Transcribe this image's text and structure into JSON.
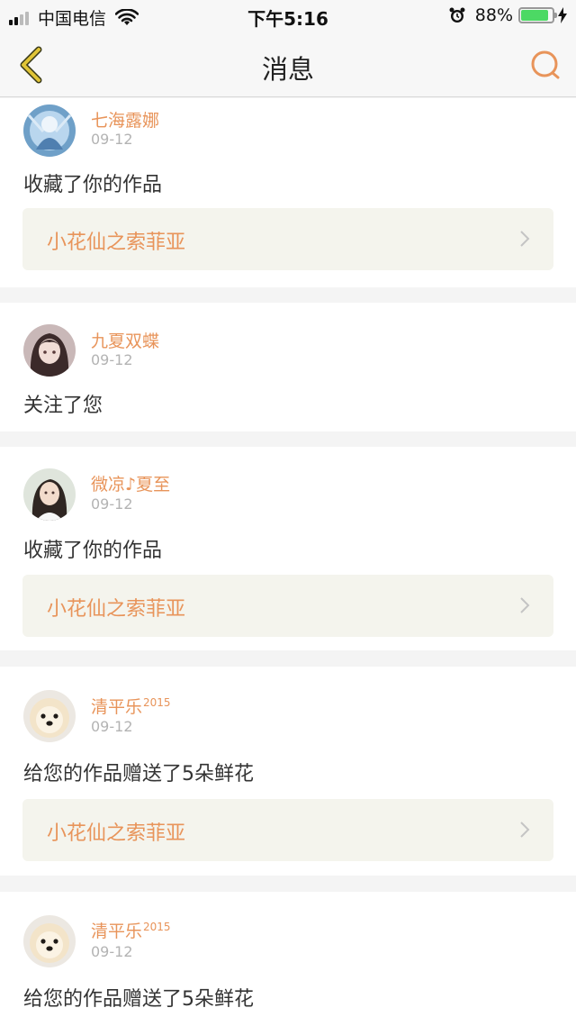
{
  "status_bar": {
    "carrier": "中国电信",
    "time": "下午5:16",
    "battery_percent": "88%",
    "battery_level": 0.88,
    "icons": [
      "signal-icon",
      "wifi-icon",
      "alarm-icon",
      "battery-icon",
      "charging-icon"
    ]
  },
  "nav": {
    "title": "消息",
    "back_icon": "back-chevron-icon",
    "search_icon": "search-icon",
    "accent_color": "#e8945a",
    "back_color": "#e0c437"
  },
  "messages": [
    {
      "username": "七海露娜",
      "date": "09-12",
      "action": "收藏了你的作品",
      "work_title": "小花仙之索菲亚"
    },
    {
      "username": "九夏双蝶",
      "date": "09-12",
      "action": "关注了您"
    },
    {
      "username": "微凉♪夏至",
      "date": "09-12",
      "action": "收藏了你的作品",
      "work_title": "小花仙之索菲亚"
    },
    {
      "username": "清平乐",
      "username_sup": "2015",
      "date": "09-12",
      "action": "给您的作品赠送了5朵鲜花",
      "work_title": "小花仙之索菲亚"
    },
    {
      "username": "清平乐",
      "username_sup": "2015",
      "date": "09-12",
      "action": "给您的作品赠送了5朵鲜花"
    }
  ]
}
